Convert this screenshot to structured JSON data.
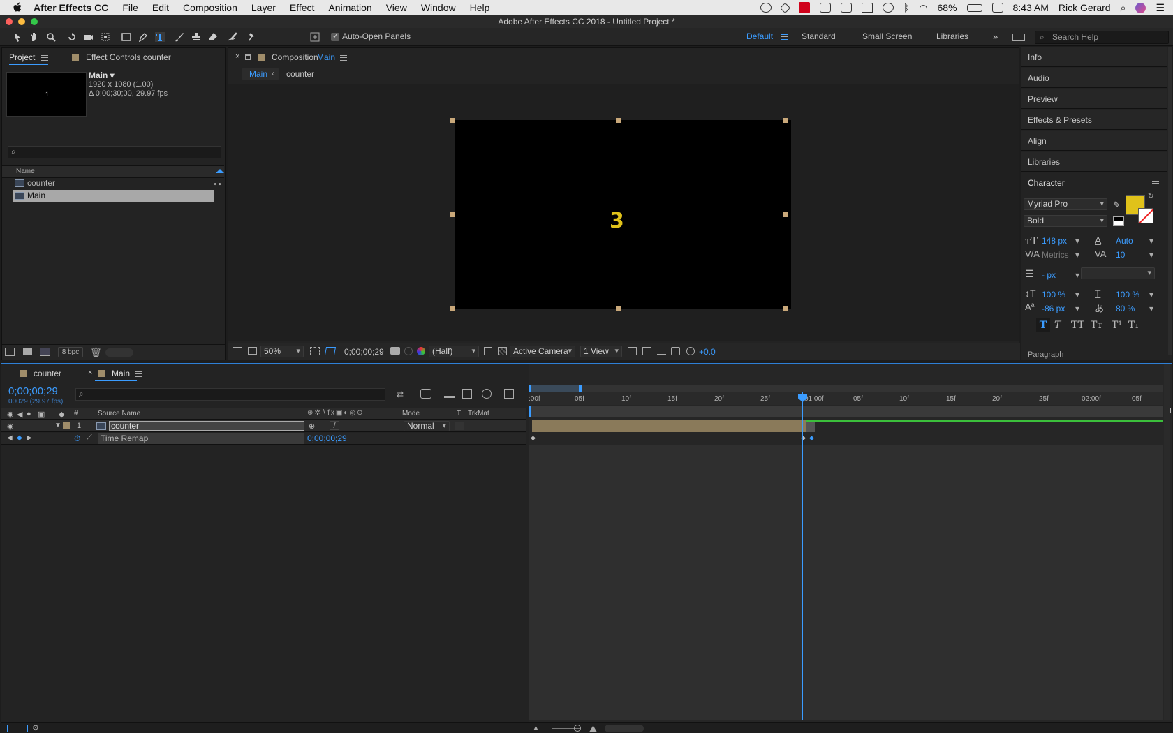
{
  "menubar": {
    "app_name": "After Effects CC",
    "items": [
      "File",
      "Edit",
      "Composition",
      "Layer",
      "Effect",
      "Animation",
      "View",
      "Window",
      "Help"
    ],
    "battery": "68%",
    "clock": "8:43 AM",
    "user": "Rick Gerard"
  },
  "window_title": "Adobe After Effects CC 2018 - Untitled Project *",
  "toolbar": {
    "auto_open_label": "Auto-Open Panels",
    "workspaces": [
      "Default",
      "Standard",
      "Small Screen",
      "Libraries"
    ],
    "search_placeholder": "Search Help"
  },
  "project": {
    "tab_project": "Project",
    "tab_effect_controls": "Effect Controls counter",
    "comp_name": "Main ▾",
    "comp_size": "1920 x 1080 (1.00)",
    "comp_duration": "Δ 0;00;30;00, 29.97 fps",
    "thumb_text": "1",
    "col_name": "Name",
    "items": [
      "counter",
      "Main"
    ],
    "bpc": "8 bpc"
  },
  "comp": {
    "tab_label": "Composition",
    "tab_name": "Main",
    "breadcrumb_main": "Main",
    "breadcrumb_counter": "counter",
    "canvas_number": "3",
    "zoom": "50%",
    "timecode": "0;00;00;29",
    "resolution": "(Half)",
    "camera": "Active Camera",
    "views": "1 View",
    "exposure": "+0.0"
  },
  "right_panels": [
    "Info",
    "Audio",
    "Preview",
    "Effects & Presets",
    "Align",
    "Libraries"
  ],
  "character": {
    "title": "Character",
    "font": "Myriad Pro",
    "style": "Bold",
    "size": "148 px",
    "leading": "Auto",
    "kerning": "Metrics",
    "tracking": "10",
    "stroke": "- px",
    "vscale": "100 %",
    "hscale": "100 %",
    "baseline": "-86 px",
    "tsume": "80 %",
    "fill_color": "#e0c21a",
    "style_buttons": [
      "T",
      "T",
      "TT",
      "Tт",
      "T¹",
      "T₁"
    ],
    "paragraph": "Paragraph"
  },
  "timeline": {
    "tab_counter": "counter",
    "tab_main": "Main",
    "timecode": "0;00;00;29",
    "frames_fps": "00029 (29.97 fps)",
    "col_source": "Source Name",
    "col_num": "#",
    "col_mode": "Mode",
    "col_t": "T",
    "col_trkmat": "TrkMat",
    "layer_num": "1",
    "layer_name": "counter",
    "layer_mode": "Normal",
    "property_name": "Time Remap",
    "property_value": "0;00;00;29",
    "ruler": [
      ":00f",
      "05f",
      "10f",
      "15f",
      "20f",
      "25f",
      "01:00f",
      "05f",
      "10f",
      "15f",
      "20f",
      "25f",
      "02:00f",
      "05f"
    ]
  }
}
